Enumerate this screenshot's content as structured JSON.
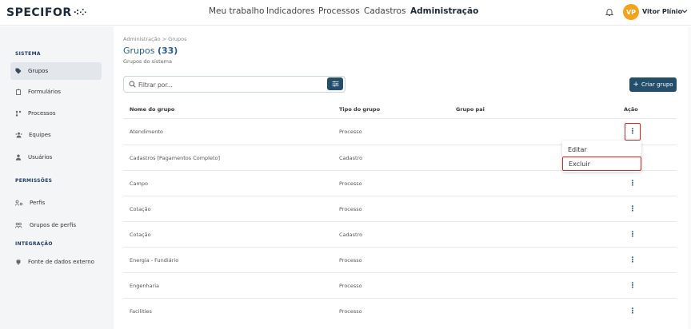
{
  "header": {
    "logo": "SPECIFOR",
    "logo_mark": "⁖⁘",
    "nav": [
      "Meu trabalho",
      "Indicadores",
      "Processos",
      "Cadastros",
      "Administração"
    ],
    "active_nav": "Administração",
    "avatar_initials": "VP",
    "user_name": "Vitor Plínio",
    "avatar_color": "#f2a31b"
  },
  "sidebar": {
    "sections": [
      {
        "title": "SISTEMA",
        "items": [
          {
            "label": "Grupos",
            "icon": "tag-icon",
            "active": true
          },
          {
            "label": "Formulários",
            "icon": "clipboard-icon"
          },
          {
            "label": "Processos",
            "icon": "process-flow-icon"
          },
          {
            "label": "Equipes",
            "icon": "team-icon"
          },
          {
            "label": "Usuários",
            "icon": "user-icon"
          }
        ]
      },
      {
        "title": "PERMISSÕES",
        "items": [
          {
            "label": "Perfis",
            "icon": "profile-key-icon"
          },
          {
            "label": "Grupos de perfis",
            "icon": "profile-group-icon"
          }
        ]
      },
      {
        "title": "INTEGRAÇÃO",
        "items": [
          {
            "label": "Fonte de dados externo",
            "icon": "plug-icon"
          }
        ]
      }
    ]
  },
  "main": {
    "breadcrumb": "Administração  >  Grupos",
    "title": "Grupos",
    "count": "(33)",
    "subtitle": "Grupos do sistema",
    "search_placeholder": "Filtrar por...",
    "create_label": "Criar grupo",
    "create_plus": "+",
    "columns": [
      "Nome do grupo",
      "Tipo do grupo",
      "Grupo pai",
      "Ação"
    ],
    "rows": [
      {
        "name": "Atendimento",
        "type": "Processo",
        "parent": ""
      },
      {
        "name": "Cadastros [Pagamentos Completo]",
        "type": "Cadastro",
        "parent": ""
      },
      {
        "name": "Campo",
        "type": "Processo",
        "parent": ""
      },
      {
        "name": "Cotação",
        "type": "Processo",
        "parent": ""
      },
      {
        "name": "Cotação",
        "type": "Cadastro",
        "parent": ""
      },
      {
        "name": "Energia - Fundiário",
        "type": "Processo",
        "parent": ""
      },
      {
        "name": "Engenharia",
        "type": "Processo",
        "parent": ""
      },
      {
        "name": "Facilities",
        "type": "Processo",
        "parent": ""
      }
    ],
    "action_glyph": "⋮",
    "menu": [
      "Editar",
      "Excluir"
    ]
  },
  "colors": {
    "primary": "#234e6c",
    "highlight": "#d9222a",
    "title": "#2b5f89"
  }
}
